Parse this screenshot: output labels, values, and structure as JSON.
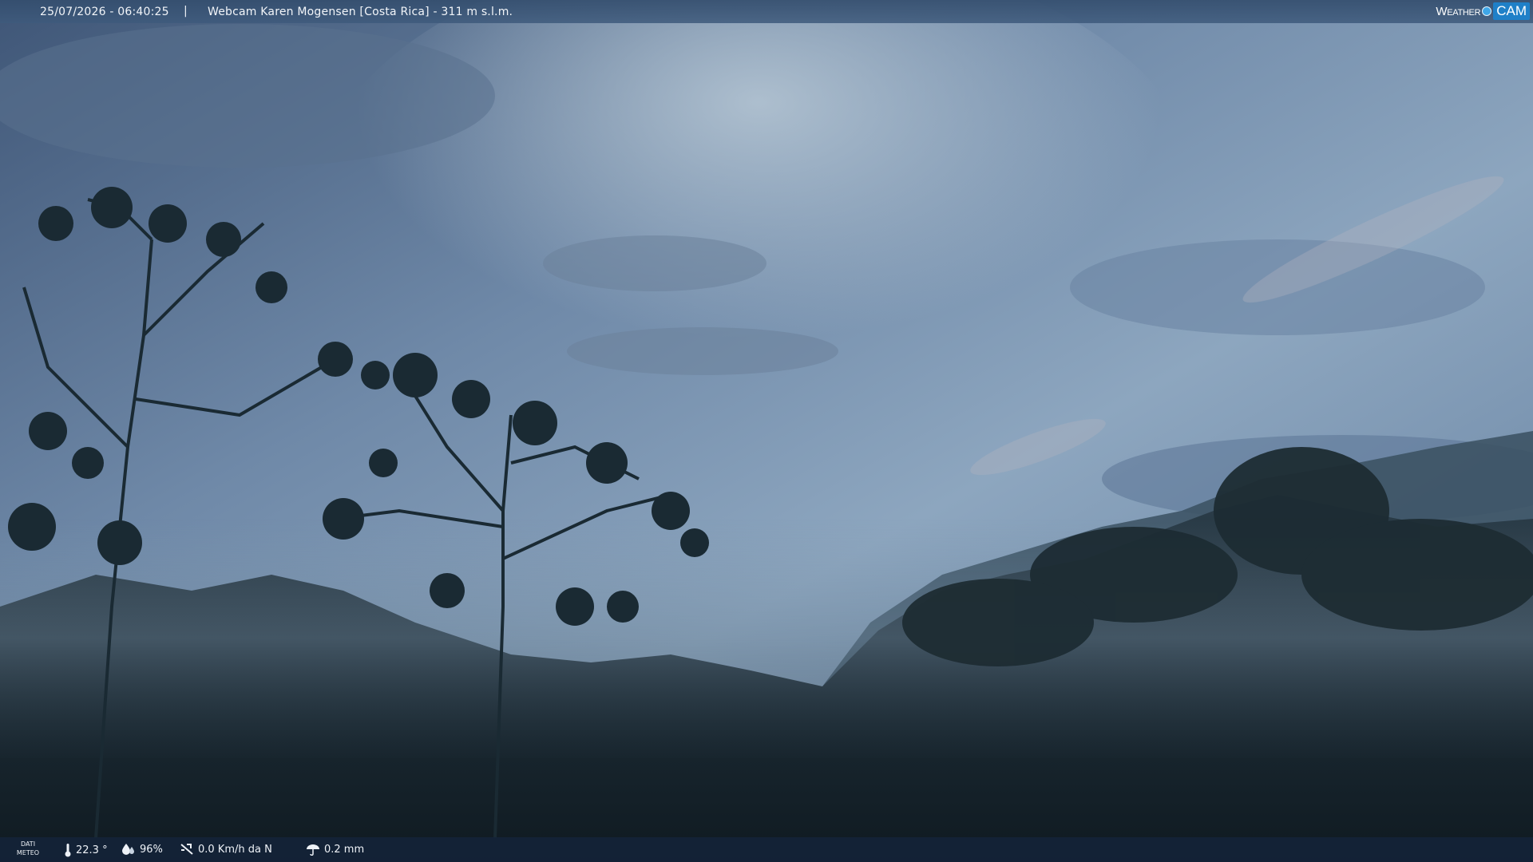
{
  "overlay": {
    "timestamp": "25/07/2026 - 06:40:25",
    "separator": "|",
    "title": "Webcam Karen Mogensen [Costa Rica]  - 311 m s.l.m.",
    "brand": {
      "word1": "Weather",
      "word2": "CAM",
      "accent_color": "#1f80c8"
    }
  },
  "weather": {
    "label_line1": "DATI",
    "label_line2": "METEO",
    "temperature": "22.3 °",
    "humidity": "96%",
    "wind": "0.0 Km/h da N",
    "rain": "0.2 mm",
    "icons": [
      "thermometer-icon",
      "humidity-icon",
      "wind-icon",
      "rain-icon"
    ]
  },
  "colors": {
    "sky_top": "#4b6384",
    "sky_mid": "#8aa3bd",
    "forest": "#1a2a33"
  }
}
